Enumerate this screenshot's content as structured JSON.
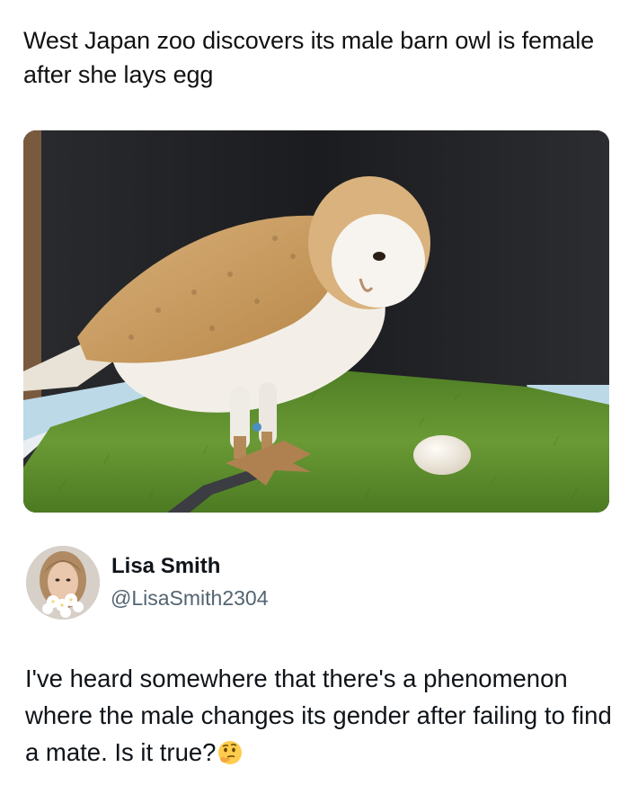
{
  "headline": "West Japan zoo discovers its male barn owl is female after she lays egg",
  "photo": {
    "icon": "barn-owl-photo",
    "colors": {
      "background": "#1e1f22",
      "grass": "#5e8f2e",
      "owl_wing": "#c79a5e",
      "owl_body": "#f4f1ec",
      "egg": "#f2ece2",
      "tray": "#b9d8e8"
    }
  },
  "tweet": {
    "author_name": "Lisa Smith",
    "author_handle": "@LisaSmith2304",
    "text": "I've heard somewhere that there's a phenomenon where the male changes its gender after failing to find a mate. Is it true?",
    "emoji": "thinking-face-icon"
  }
}
